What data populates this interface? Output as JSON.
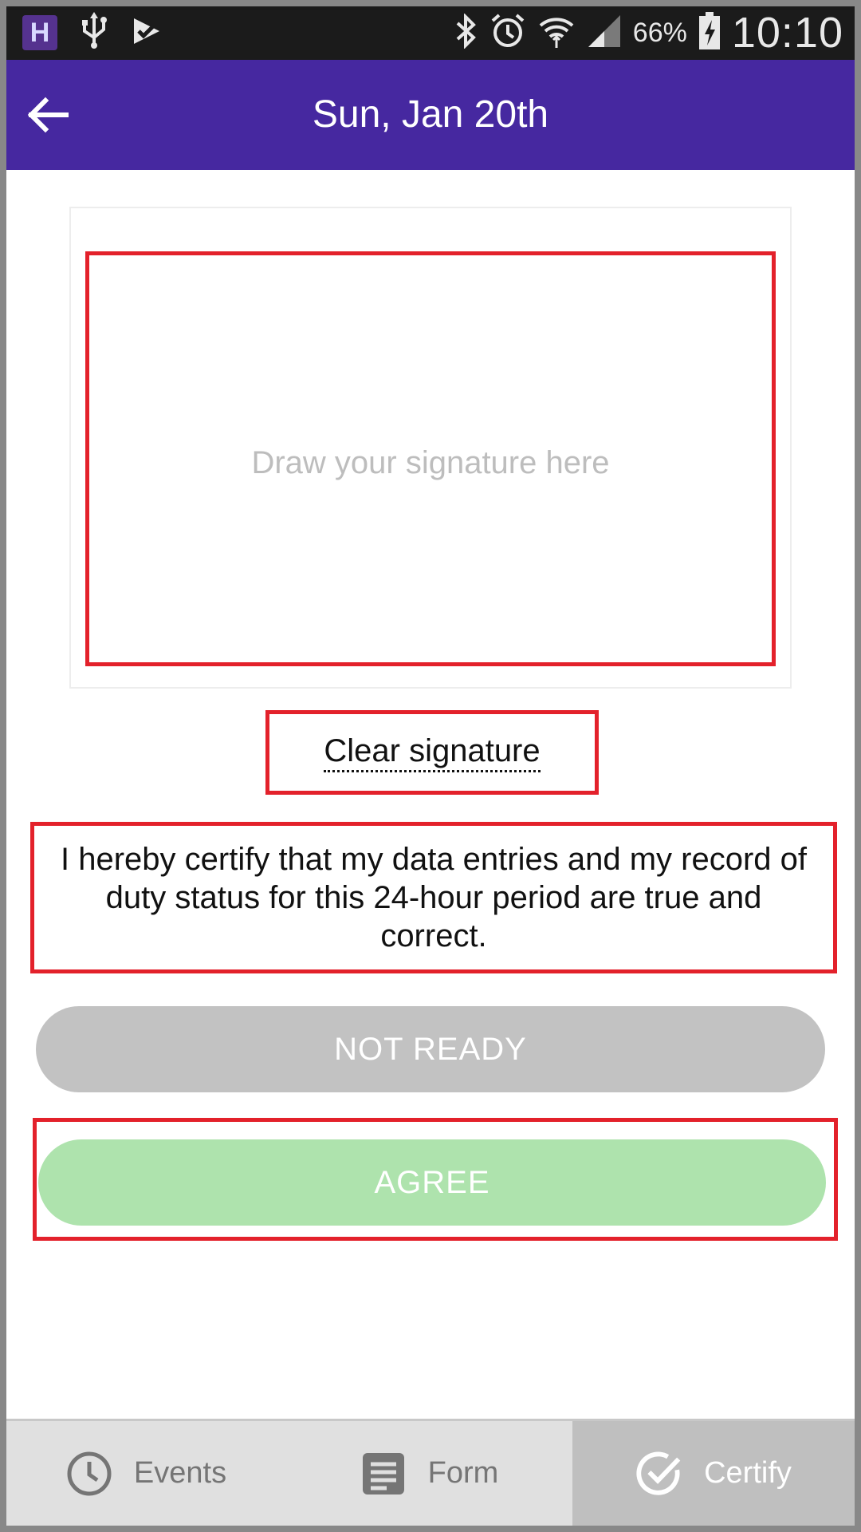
{
  "status_bar": {
    "app_badge": "H",
    "battery_percent": "66%",
    "time": "10:10"
  },
  "app_bar": {
    "title": "Sun, Jan 20th"
  },
  "signature": {
    "placeholder": "Draw your signature here",
    "clear_label": "Clear signature"
  },
  "certification": {
    "text": "I hereby certify that my data entries and my record of duty status for this 24-hour period are true and correct."
  },
  "buttons": {
    "not_ready_label": "NOT READY",
    "agree_label": "AGREE"
  },
  "bottom_nav": {
    "items": [
      {
        "label": "Events",
        "icon": "clock-icon",
        "active": false
      },
      {
        "label": "Form",
        "icon": "form-icon",
        "active": false
      },
      {
        "label": "Certify",
        "icon": "check-circle-icon",
        "active": true
      }
    ]
  },
  "colors": {
    "app_bar": "#4628a0",
    "highlight_border": "#e3212b",
    "not_ready_button": "#c2c2c2",
    "agree_button": "#aee3ad",
    "nav_active": "#bfbfbf"
  }
}
